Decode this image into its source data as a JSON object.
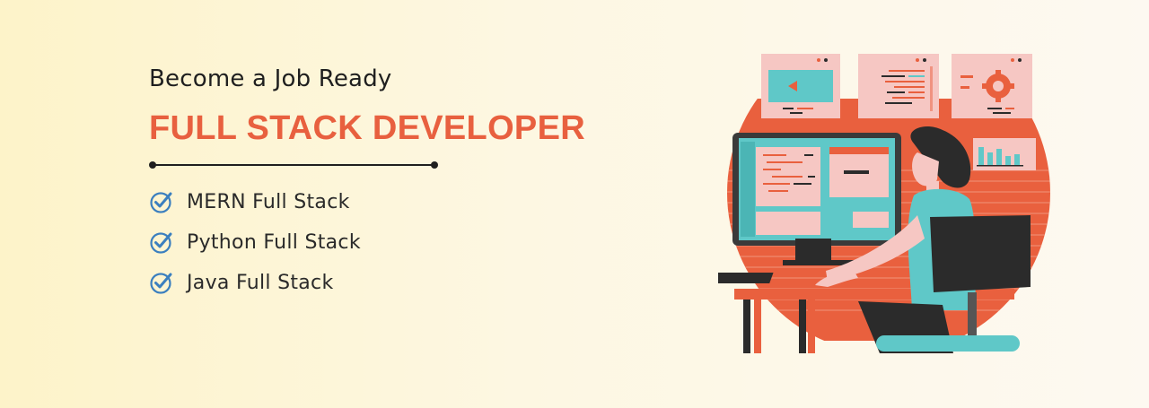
{
  "banner": {
    "eyebrow": "Become a Job Ready",
    "headline": "FULL STACK DEVELOPER",
    "items": [
      {
        "label": "MERN Full Stack",
        "icon": "check-circle-icon"
      },
      {
        "label": "Python Full Stack",
        "icon": "check-circle-icon"
      },
      {
        "label": "Java Full Stack",
        "icon": "check-circle-icon"
      }
    ]
  },
  "colors": {
    "accent": "#e8603f",
    "teal": "#5fc8c8",
    "check": "#3b7fbf",
    "dark": "#2b2b2b",
    "pink": "#f6c7c3"
  }
}
